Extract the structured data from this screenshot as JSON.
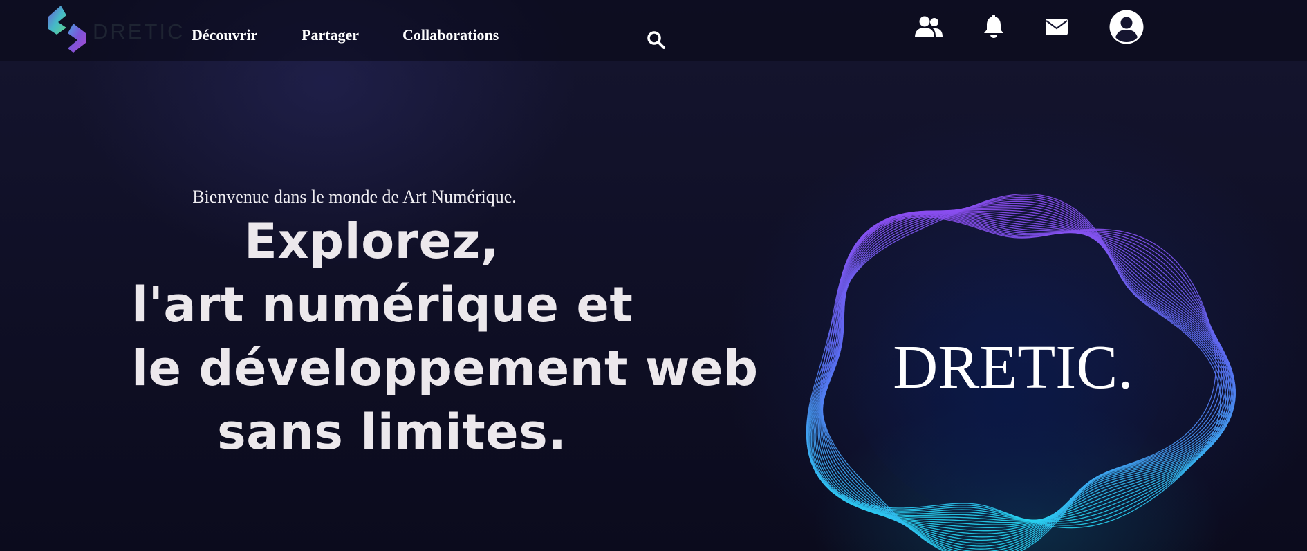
{
  "header": {
    "logo_text": "DRETIC",
    "nav": [
      {
        "label": "Découvrir"
      },
      {
        "label": "Partager"
      },
      {
        "label": "Collaborations"
      }
    ],
    "icons": [
      "search-icon",
      "users-icon",
      "bell-icon",
      "envelope-icon",
      "user-circle-icon"
    ]
  },
  "hero": {
    "welcome": "Bienvenue dans le monde de Art Numérique.",
    "lines": [
      "Explorez,",
      "l'art numérique et",
      "le développement web",
      "sans limites."
    ],
    "brand": "DRETIC."
  },
  "colors": {
    "background": "#101027",
    "ring_top": "#8a4df0",
    "ring_bottom": "#26d3f0",
    "text": "#ece8ec"
  }
}
